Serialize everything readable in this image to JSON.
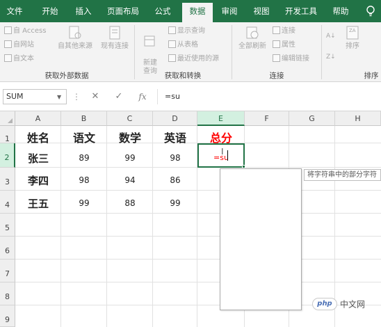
{
  "tabs": [
    {
      "label": "文件",
      "active": false
    },
    {
      "label": "开始",
      "active": false
    },
    {
      "label": "插入",
      "active": false
    },
    {
      "label": "页面布局",
      "active": false
    },
    {
      "label": "公式",
      "active": false
    },
    {
      "label": "数据",
      "active": true
    },
    {
      "label": "审阅",
      "active": false
    },
    {
      "label": "视图",
      "active": false
    },
    {
      "label": "开发工具",
      "active": false
    },
    {
      "label": "帮助",
      "active": false
    }
  ],
  "ribbon": {
    "external": {
      "from_access": "自 Access",
      "from_web": "自网站",
      "from_text": "自文本",
      "other_sources": "自其他来源",
      "existing_connections": "现有连接",
      "group_label": "获取外部数据"
    },
    "transform": {
      "new_query": "新建\n查询",
      "show_queries": "显示查询",
      "from_table": "从表格",
      "recent_sources": "最近使用的源",
      "group_label": "获取和转换"
    },
    "connections": {
      "refresh_all": "全部刷新",
      "connections": "连接",
      "properties": "属性",
      "edit_links": "编辑链接",
      "group_label": "连接"
    },
    "sort": {
      "sort": "排序",
      "group_label": "排序"
    }
  },
  "formula_bar": {
    "name_box": "SUM",
    "cancel": "✕",
    "enter": "✓",
    "fx": "fx",
    "content": "=su"
  },
  "grid": {
    "columns": [
      "A",
      "B",
      "C",
      "D",
      "E",
      "F",
      "G",
      "H"
    ],
    "rows": [
      "1",
      "2",
      "3",
      "4",
      "5",
      "6",
      "7",
      "8",
      "9"
    ],
    "selected_column": "E",
    "selected_row": "2",
    "headers": [
      "姓名",
      "语文",
      "数学",
      "英语",
      "总分"
    ],
    "data": [
      {
        "name": "张三",
        "chinese": "89",
        "math": "99",
        "english": "98"
      },
      {
        "name": "李四",
        "chinese": "98",
        "math": "94",
        "english": "86"
      },
      {
        "name": "王五",
        "chinese": "99",
        "math": "88",
        "english": "99"
      }
    ],
    "editing_value": "=su"
  },
  "autocomplete_tip": "将字符串中的部分字符",
  "watermark": {
    "logo": "php",
    "text": "中文网"
  },
  "colors": {
    "accent": "#217346",
    "red": "#ff0000"
  }
}
